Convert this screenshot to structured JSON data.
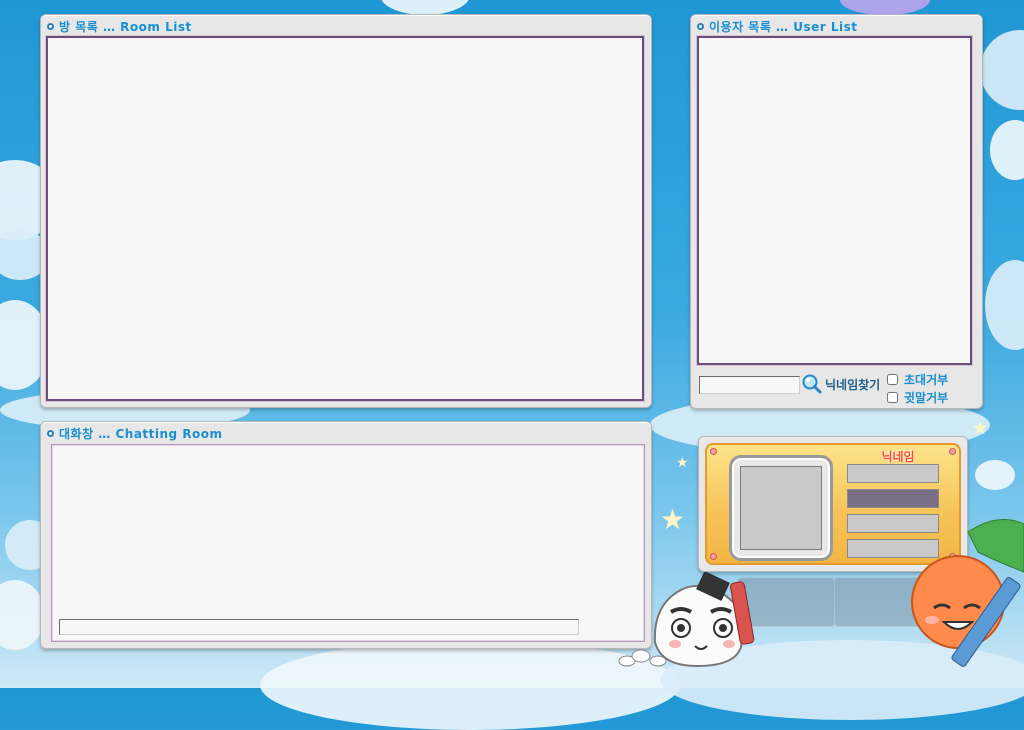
{
  "room_list": {
    "title": "방 목록 … Room List"
  },
  "user_list": {
    "title": "이용자 목록 … User List",
    "search": {
      "value": "",
      "button_label": "닉네임찾기"
    },
    "options": [
      {
        "label": "초대거부",
        "checked": false
      },
      {
        "label": "귓말거부",
        "checked": false
      }
    ]
  },
  "chat": {
    "title": "대화창  … Chatting Room",
    "input_value": ""
  },
  "profile": {
    "nickname_label": "닉네임",
    "selected_row": 2
  },
  "icons": {
    "title_bullet": "circle-bullet-icon",
    "search": "magnifier-icon"
  },
  "colors": {
    "title_text": "#1a8fd0",
    "selected_row": "#7a6f86",
    "nickname_label": "#ff4a2b"
  }
}
